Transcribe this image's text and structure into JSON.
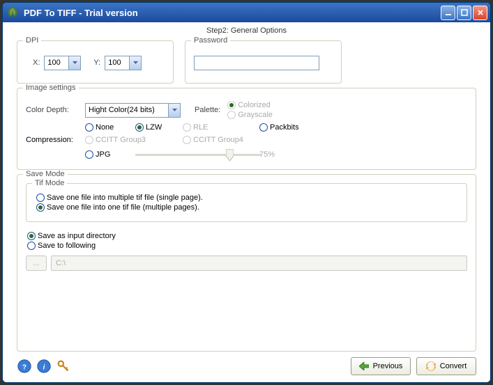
{
  "title": "PDF To TIFF - Trial version",
  "step_label": "Step2: General Options",
  "dpi": {
    "group_label": "DPI",
    "x_label": "X:",
    "x_value": "100",
    "y_label": "Y:",
    "y_value": "100"
  },
  "password": {
    "group_label": "Password",
    "value": ""
  },
  "image_settings": {
    "group_label": "Image settings",
    "color_depth_label": "Color Depth:",
    "color_depth_value": "Hight Color(24 bits)",
    "palette_label": "Palette:",
    "palette_colorized": "Colorized",
    "palette_grayscale": "Grayscale",
    "compression_label": "Compression:",
    "none": "None",
    "lzw": "LZW",
    "rle": "RLE",
    "packbits": "Packbits",
    "ccitt3": "CCITT Group3",
    "ccitt4": "CCITT Group4",
    "jpg": "JPG",
    "jpg_quality": "75%"
  },
  "save_mode": {
    "group_label": "Save Mode",
    "tif_mode_label": "Tif Mode",
    "single_page": "Save one file into multiple tif file (single page).",
    "multiple_pages": "Save one file into one tif file (multiple pages).",
    "save_as_input": "Save as input directory",
    "save_to_following": "Save to following",
    "browse_label": "...",
    "path_value": "C:\\"
  },
  "footer": {
    "previous": "Previous",
    "convert": "Convert"
  }
}
